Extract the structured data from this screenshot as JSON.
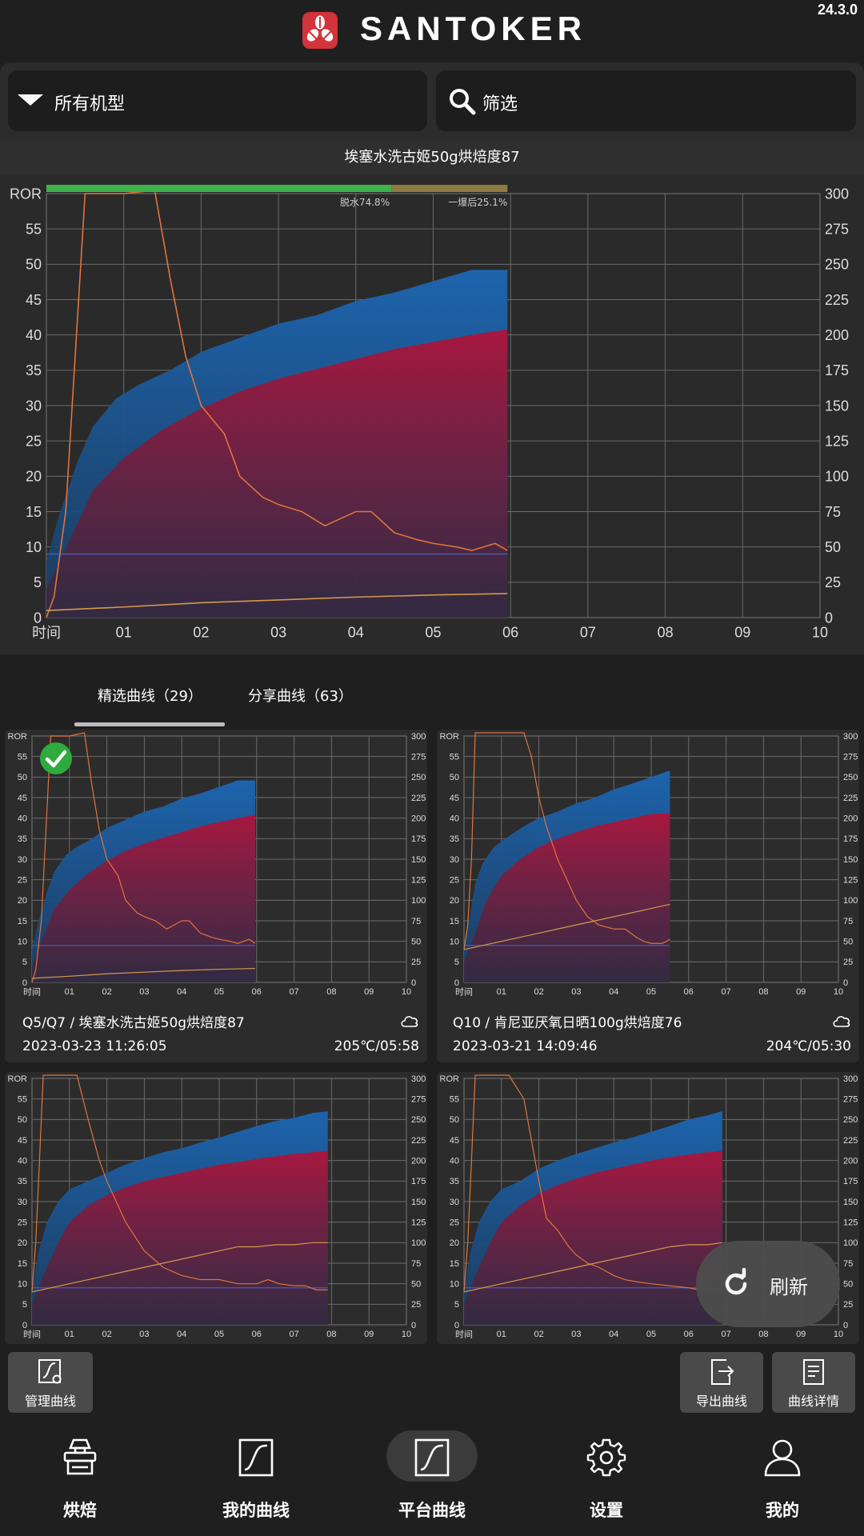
{
  "app": {
    "brand": "SANTOKER",
    "version": "24.3.0"
  },
  "filters": {
    "machine_label": "所有机型",
    "search_label": "筛选"
  },
  "main_chart": {
    "title": "埃塞水洗古姬50g烘焙度87",
    "left_axis_label": "ROR",
    "x_axis_label": "时间",
    "progress": {
      "dry_label": "脱水74.8%",
      "dry_fraction": 0.748,
      "post_crack_label": "一爆后25.1%",
      "post_crack_fraction": 0.251,
      "dry_color": "#3fb24a",
      "post_crack_color": "#8e7b3f"
    }
  },
  "tabs": [
    {
      "label": "精选曲线（29）",
      "active": true
    },
    {
      "label": "分享曲线（63）",
      "active": false
    }
  ],
  "cards": [
    {
      "title": "Q5/Q7 / 埃塞水洗古姬50g烘焙度87",
      "date": "2023-03-23 11:26:05",
      "meta": "205℃/05:58",
      "selected": true,
      "cloud": "cloud-icon"
    },
    {
      "title": "Q10 / 肯尼亚厌氧日晒100g烘焙度76",
      "date": "2023-03-21 14:09:46",
      "meta": "204℃/05:30",
      "selected": false,
      "cloud": "cloud-icon"
    },
    {
      "title": "",
      "date": "",
      "meta": "",
      "selected": false
    },
    {
      "title": "",
      "date": "",
      "meta": "",
      "selected": false
    }
  ],
  "actions": {
    "manage": "管理曲线",
    "export": "导出曲线",
    "details": "曲线详情",
    "refresh": "刷新"
  },
  "nav": [
    {
      "label": "烘焙",
      "icon": "roaster-icon",
      "active": false
    },
    {
      "label": "我的曲线",
      "icon": "curve-icon",
      "active": false
    },
    {
      "label": "平台曲线",
      "icon": "curve-icon",
      "active": true
    },
    {
      "label": "设置",
      "icon": "gear-icon",
      "active": false
    },
    {
      "label": "我的",
      "icon": "user-icon",
      "active": false
    }
  ],
  "colors": {
    "bean_temp": "#1f5fa8",
    "env_temp": "#a31843",
    "ror_line": "#e0743c",
    "fire_line": "#d49a4b",
    "grid": "#6b6b6b",
    "check": "#2eaa3e"
  },
  "chart_data": [
    {
      "type": "area",
      "title": "埃塞水洗古姬50g烘焙度87",
      "xlabel": "时间",
      "ylabel": "ROR",
      "x_ticks": [
        "01",
        "02",
        "03",
        "04",
        "05",
        "06",
        "07",
        "08",
        "09",
        "10"
      ],
      "y_left_ticks": [
        0,
        5,
        10,
        15,
        20,
        25,
        30,
        35,
        40,
        45,
        50,
        55
      ],
      "y_right_ticks": [
        0,
        25,
        50,
        75,
        100,
        125,
        150,
        175,
        200,
        225,
        250,
        275,
        300
      ],
      "xlim": [
        0,
        10
      ],
      "ylim_left": [
        0,
        60
      ],
      "ylim_right": [
        0,
        300
      ],
      "grid": true,
      "series": [
        {
          "axis": "right",
          "x": [
            0,
            0.15,
            0.4,
            0.6,
            0.9,
            1.2,
            1.6,
            2.0,
            2.5,
            3.0,
            3.5,
            4.0,
            4.5,
            5.0,
            5.5,
            5.96
          ],
          "values": [
            40,
            70,
            110,
            135,
            155,
            165,
            175,
            188,
            198,
            208,
            214,
            224,
            230,
            238,
            246,
            246
          ]
        },
        {
          "axis": "right",
          "x": [
            0,
            0.3,
            0.6,
            1.0,
            1.5,
            2.0,
            2.5,
            3.0,
            3.5,
            4.0,
            4.5,
            5.0,
            5.5,
            5.96
          ],
          "values": [
            20,
            55,
            90,
            113,
            133,
            148,
            160,
            169,
            176,
            183,
            190,
            195,
            200,
            204
          ]
        },
        {
          "axis": "left",
          "x": [
            0,
            0.1,
            0.25,
            0.5,
            1.0,
            1.4,
            1.6,
            1.8,
            2.0,
            2.3,
            2.5,
            2.8,
            3.0,
            3.3,
            3.6,
            3.8,
            4.0,
            4.2,
            4.5,
            4.8,
            5.0,
            5.3,
            5.5,
            5.8,
            5.96
          ],
          "values": [
            0,
            3,
            15,
            60,
            60,
            62,
            48,
            37,
            30,
            26,
            20,
            17,
            16,
            15,
            13,
            14,
            15,
            15,
            12,
            11,
            10.5,
            10,
            9.5,
            10.5,
            9.5
          ]
        },
        {
          "axis": "left",
          "x": [
            0,
            1,
            2,
            3,
            4,
            5,
            5.96
          ],
          "values": [
            1,
            1.5,
            2.1,
            2.5,
            2.9,
            3.2,
            3.4
          ]
        }
      ]
    },
    {
      "type": "area",
      "title": "Q5/Q7 / 埃塞水洗古姬50g烘焙度87",
      "xlabel": "时间",
      "ylabel": "ROR",
      "x_ticks": [
        "01",
        "02",
        "03",
        "04",
        "05",
        "06",
        "07",
        "08",
        "09",
        "10"
      ],
      "xlim": [
        0,
        10
      ],
      "ylim_left": [
        0,
        60
      ],
      "ylim_right": [
        0,
        300
      ],
      "series": [
        {
          "axis": "right",
          "x": [
            0,
            0.15,
            0.4,
            0.6,
            0.9,
            1.2,
            1.6,
            2.0,
            2.5,
            3.0,
            3.5,
            4.0,
            4.5,
            5.0,
            5.5,
            5.96
          ],
          "values": [
            40,
            70,
            110,
            135,
            155,
            165,
            175,
            188,
            198,
            208,
            214,
            224,
            230,
            238,
            246,
            246
          ]
        },
        {
          "axis": "right",
          "x": [
            0,
            0.3,
            0.6,
            1.0,
            1.5,
            2.0,
            2.5,
            3.0,
            3.5,
            4.0,
            4.5,
            5.0,
            5.5,
            5.96
          ],
          "values": [
            20,
            55,
            90,
            113,
            133,
            148,
            160,
            169,
            176,
            183,
            190,
            195,
            200,
            204
          ]
        },
        {
          "axis": "left",
          "x": [
            0,
            0.1,
            0.25,
            0.5,
            1.0,
            1.4,
            1.6,
            1.8,
            2.0,
            2.3,
            2.5,
            2.8,
            3.0,
            3.3,
            3.6,
            3.8,
            4.0,
            4.2,
            4.5,
            4.8,
            5.0,
            5.3,
            5.5,
            5.8,
            5.96
          ],
          "values": [
            0,
            3,
            15,
            60,
            60,
            62,
            48,
            37,
            30,
            26,
            20,
            17,
            16,
            15,
            13,
            14,
            15,
            15,
            12,
            11,
            10.5,
            10,
            9.5,
            10.5,
            9.5
          ]
        },
        {
          "axis": "left",
          "x": [
            0,
            1,
            2,
            3,
            4,
            5,
            5.96
          ],
          "values": [
            1,
            1.5,
            2.1,
            2.5,
            2.9,
            3.2,
            3.4
          ]
        }
      ]
    },
    {
      "type": "area",
      "title": "Q10 / 肯尼亚厌氧日晒100g烘焙度76",
      "xlabel": "时间",
      "ylabel": "ROR",
      "x_ticks": [
        "01",
        "02",
        "03",
        "04",
        "05",
        "06",
        "07",
        "08",
        "09",
        "10"
      ],
      "xlim": [
        0,
        10
      ],
      "ylim_left": [
        0,
        60
      ],
      "ylim_right": [
        0,
        300
      ],
      "series": [
        {
          "axis": "right",
          "x": [
            0,
            0.15,
            0.3,
            0.5,
            0.8,
            1.2,
            1.6,
            2.0,
            2.5,
            3.0,
            3.5,
            4.0,
            4.5,
            5.0,
            5.5
          ],
          "values": [
            45,
            80,
            120,
            145,
            165,
            178,
            190,
            200,
            208,
            218,
            225,
            235,
            242,
            250,
            258
          ]
        },
        {
          "axis": "right",
          "x": [
            0,
            0.3,
            0.6,
            1.0,
            1.5,
            2.0,
            2.5,
            3.0,
            3.5,
            4.0,
            4.5,
            5.0,
            5.5
          ],
          "values": [
            25,
            60,
            100,
            130,
            150,
            165,
            175,
            183,
            190,
            195,
            200,
            205,
            206
          ]
        },
        {
          "axis": "left",
          "x": [
            0,
            0.1,
            0.2,
            0.3,
            1.0,
            1.6,
            1.8,
            2.0,
            2.2,
            2.5,
            2.8,
            3.0,
            3.3,
            3.6,
            4.0,
            4.3,
            4.6,
            4.8,
            5.0,
            5.3,
            5.5
          ],
          "values": [
            8,
            14,
            30,
            62,
            62,
            62,
            55,
            45,
            38,
            30,
            24,
            20,
            16,
            14,
            13,
            13,
            11,
            10,
            9.5,
            9.5,
            10.5
          ]
        },
        {
          "axis": "left",
          "x": [
            0,
            0.5,
            1.0,
            1.5,
            2.0,
            2.5,
            3.0,
            3.5,
            4.0,
            4.5,
            5.0,
            5.5
          ],
          "values": [
            8,
            9,
            10,
            11,
            12,
            13,
            14,
            15,
            16,
            17,
            18,
            19
          ]
        }
      ]
    },
    {
      "type": "area",
      "xlabel": "时间",
      "ylabel": "ROR",
      "x_ticks": [
        "01",
        "02",
        "03",
        "04",
        "05",
        "06",
        "07",
        "08",
        "09",
        "10"
      ],
      "xlim": [
        0,
        10
      ],
      "ylim_left": [
        0,
        60
      ],
      "ylim_right": [
        0,
        300
      ],
      "series": [
        {
          "axis": "right",
          "x": [
            0,
            0.15,
            0.4,
            0.7,
            1.0,
            1.5,
            2.0,
            2.5,
            3.0,
            3.5,
            4.0,
            4.5,
            5.0,
            5.5,
            6.0,
            6.5,
            7.0,
            7.5,
            7.9
          ],
          "values": [
            40,
            85,
            125,
            150,
            165,
            175,
            185,
            195,
            203,
            210,
            215,
            222,
            228,
            235,
            242,
            248,
            252,
            258,
            260
          ]
        },
        {
          "axis": "right",
          "x": [
            0,
            0.3,
            0.7,
            1.0,
            1.5,
            2.0,
            2.5,
            3.0,
            3.5,
            4.0,
            4.5,
            5.0,
            5.5,
            6.0,
            6.5,
            7.0,
            7.5,
            7.9
          ],
          "values": [
            25,
            60,
            100,
            125,
            145,
            158,
            167,
            175,
            180,
            185,
            190,
            195,
            198,
            202,
            205,
            208,
            210,
            212
          ]
        },
        {
          "axis": "left",
          "x": [
            0,
            0.1,
            0.2,
            0.3,
            1.0,
            1.2,
            1.5,
            1.8,
            2.0,
            2.5,
            3.0,
            3.5,
            4.0,
            4.5,
            5.0,
            5.5,
            6.0,
            6.3,
            6.6,
            7.0,
            7.3,
            7.6,
            7.9
          ],
          "values": [
            8,
            20,
            40,
            62,
            62,
            62,
            50,
            40,
            35,
            25,
            18,
            14,
            12,
            11,
            11,
            10,
            10,
            11,
            10,
            9.5,
            9.5,
            8.5,
            8.5
          ]
        },
        {
          "axis": "left",
          "x": [
            0,
            0.5,
            1.0,
            1.5,
            2.0,
            2.5,
            3.0,
            3.5,
            4.0,
            4.5,
            5.0,
            5.5,
            6.0,
            6.5,
            7.0,
            7.5,
            7.9
          ],
          "values": [
            8,
            9,
            10,
            11,
            12,
            13,
            14,
            15,
            16,
            17,
            18,
            19,
            19,
            19.5,
            19.5,
            20,
            20
          ]
        }
      ]
    },
    {
      "type": "area",
      "xlabel": "时间",
      "ylabel": "ROR",
      "x_ticks": [
        "01",
        "02",
        "03",
        "04",
        "05",
        "06",
        "07",
        "08",
        "09",
        "10"
      ],
      "xlim": [
        0,
        10
      ],
      "ylim_left": [
        0,
        60
      ],
      "ylim_right": [
        0,
        300
      ],
      "series": [
        {
          "axis": "right",
          "x": [
            0,
            0.15,
            0.4,
            0.7,
            1.0,
            1.5,
            2.0,
            2.5,
            3.0,
            3.5,
            4.0,
            4.5,
            5.0,
            5.5,
            6.0,
            6.5,
            6.9
          ],
          "values": [
            40,
            85,
            125,
            150,
            165,
            175,
            190,
            200,
            208,
            215,
            222,
            228,
            235,
            242,
            250,
            255,
            260
          ]
        },
        {
          "axis": "right",
          "x": [
            0,
            0.3,
            0.7,
            1.0,
            1.5,
            2.0,
            2.5,
            3.0,
            3.5,
            4.0,
            4.5,
            5.0,
            5.5,
            6.0,
            6.5,
            6.9
          ],
          "values": [
            25,
            60,
            100,
            125,
            145,
            160,
            170,
            178,
            185,
            190,
            195,
            200,
            204,
            207,
            210,
            212
          ]
        },
        {
          "axis": "left",
          "x": [
            0,
            0.1,
            0.2,
            0.3,
            1.2,
            1.6,
            1.8,
            2.0,
            2.2,
            2.5,
            2.8,
            3.0,
            3.3,
            3.6,
            4.0,
            4.3,
            4.6,
            5.0,
            5.5,
            6.0,
            6.3,
            6.6,
            6.9
          ],
          "values": [
            8,
            20,
            40,
            62,
            62,
            55,
            45,
            35,
            26,
            23,
            19,
            17,
            15,
            14,
            12,
            11,
            10.5,
            10,
            9.5,
            9,
            8.5,
            8.5,
            8.5
          ]
        },
        {
          "axis": "left",
          "x": [
            0,
            0.5,
            1.0,
            1.5,
            2.0,
            2.5,
            3.0,
            3.5,
            4.0,
            4.5,
            5.0,
            5.5,
            6.0,
            6.5,
            6.9
          ],
          "values": [
            8,
            9,
            10,
            11,
            12,
            13,
            14,
            15,
            16,
            17,
            18,
            19,
            19.5,
            19.5,
            20
          ]
        }
      ]
    }
  ]
}
